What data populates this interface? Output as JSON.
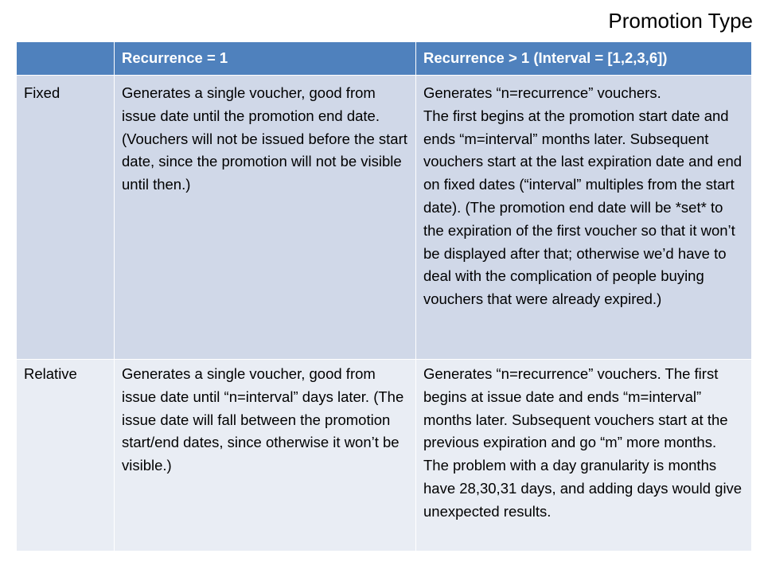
{
  "title": "Promotion Type",
  "table": {
    "header": {
      "corner": "",
      "col1": "Recurrence = 1",
      "col2": "Recurrence > 1  (Interval = [1,2,3,6])"
    },
    "rows": [
      {
        "label": "Fixed",
        "col1": "Generates a single voucher, good from issue date until the promotion end date. (Vouchers will not be issued before the start date, since the promotion will not be visible until then.)",
        "col2": "Generates “n=recurrence” vouchers.\nThe first begins at the promotion start date and ends “m=interval” months later. Subsequent vouchers start at the last expiration date and end on fixed dates (“interval” multiples from the start date). (The promotion end date will be *set* to the expiration of the first voucher so that it won’t be displayed after that; otherwise we’d have to deal with the complication of people buying vouchers that were already expired.)"
      },
      {
        "label": "Relative",
        "col1": "Generates a single voucher, good from issue date until “n=interval” days later. (The issue date will fall between the promotion start/end dates, since otherwise it won’t be visible.)",
        "col2": "Generates “n=recurrence” vouchers. The first begins at issue date and ends “m=interval” months later. Subsequent vouchers start at the previous expiration and go “m” more months.  The problem with a day granularity is months have 28,30,31 days, and adding days would give unexpected results."
      }
    ]
  },
  "colors": {
    "header_bg": "#4f81bd",
    "row1_bg": "#d0d8e8",
    "row2_bg": "#e9edf4"
  }
}
